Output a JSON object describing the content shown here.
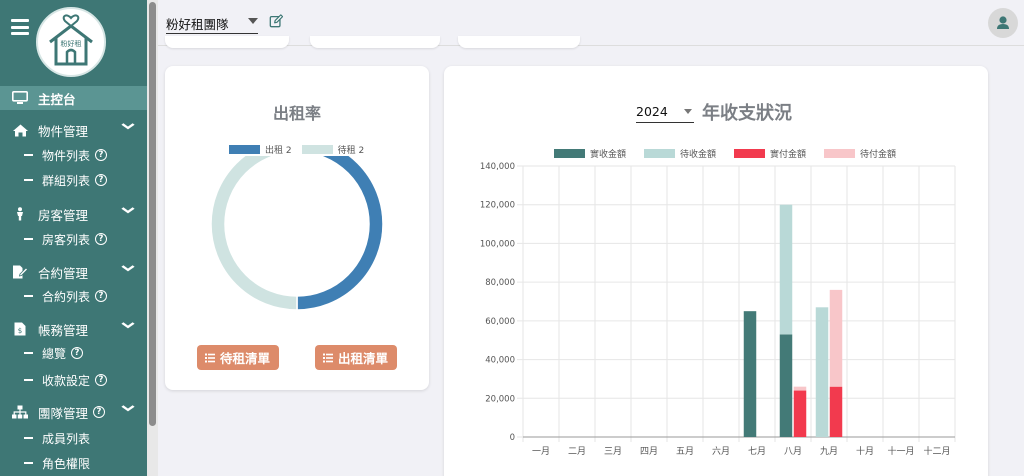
{
  "app": {
    "logo_text": "粉好租",
    "team_name": "粉好租團隊"
  },
  "sidebar": {
    "items": [
      {
        "label": "主控台",
        "icon": "monitor-icon",
        "active": true
      },
      {
        "label": "物件管理",
        "icon": "home-icon",
        "expanded": true,
        "children": [
          {
            "label": "物件列表",
            "help": true
          },
          {
            "label": "群組列表",
            "help": true
          }
        ]
      },
      {
        "label": "房客管理",
        "icon": "person-icon",
        "expanded": true,
        "children": [
          {
            "label": "房客列表",
            "help": true
          }
        ]
      },
      {
        "label": "合約管理",
        "icon": "contract-icon",
        "expanded": true,
        "children": [
          {
            "label": "合約列表",
            "help": true
          }
        ]
      },
      {
        "label": "帳務管理",
        "icon": "invoice-icon",
        "expanded": true,
        "children": [
          {
            "label": "總覽",
            "help": true
          },
          {
            "label": "收款設定",
            "help": true
          }
        ]
      },
      {
        "label": "團隊管理",
        "icon": "sitemap-icon",
        "expanded": true,
        "help": true,
        "children": [
          {
            "label": "成員列表",
            "help": false
          },
          {
            "label": "角色權限",
            "help": false
          }
        ]
      }
    ]
  },
  "occupancy": {
    "title": "出租率",
    "legend": [
      {
        "label": "出租 2",
        "color": "#3f7fb4"
      },
      {
        "label": "待租 2",
        "color": "#cfe3e1"
      }
    ],
    "rented": 2,
    "vacant": 2,
    "buttons": {
      "vacant_list": "待租清單",
      "rented_list": "出租清單"
    }
  },
  "revenue": {
    "year": "2024",
    "title": "年收支狀況"
  },
  "chart_data": {
    "type": "bar",
    "stacked": true,
    "categories": [
      "一月",
      "二月",
      "三月",
      "四月",
      "五月",
      "六月",
      "七月",
      "八月",
      "九月",
      "十月",
      "十一月",
      "十二月"
    ],
    "ylim": [
      0,
      140000
    ],
    "yticks": [
      "0",
      "20,000",
      "40,000",
      "60,000",
      "80,000",
      "100,000",
      "120,000",
      "140,000"
    ],
    "legend_position": "top",
    "grid": true,
    "series": [
      {
        "name": "實收金額",
        "stack": "income",
        "color": "#437a77",
        "values": [
          0,
          0,
          0,
          0,
          0,
          0,
          65000,
          53000,
          0,
          0,
          0,
          0
        ]
      },
      {
        "name": "待收金額",
        "stack": "income",
        "color": "#b9d9d7",
        "values": [
          0,
          0,
          0,
          0,
          0,
          0,
          0,
          67000,
          67000,
          0,
          0,
          0
        ]
      },
      {
        "name": "實付金額",
        "stack": "expense",
        "color": "#f23a4e",
        "values": [
          0,
          0,
          0,
          0,
          0,
          0,
          0,
          24000,
          26000,
          0,
          0,
          0
        ]
      },
      {
        "name": "待付金額",
        "stack": "expense",
        "color": "#f8c6c9",
        "values": [
          0,
          0,
          0,
          0,
          0,
          0,
          0,
          2000,
          50000,
          0,
          0,
          0
        ]
      }
    ]
  }
}
